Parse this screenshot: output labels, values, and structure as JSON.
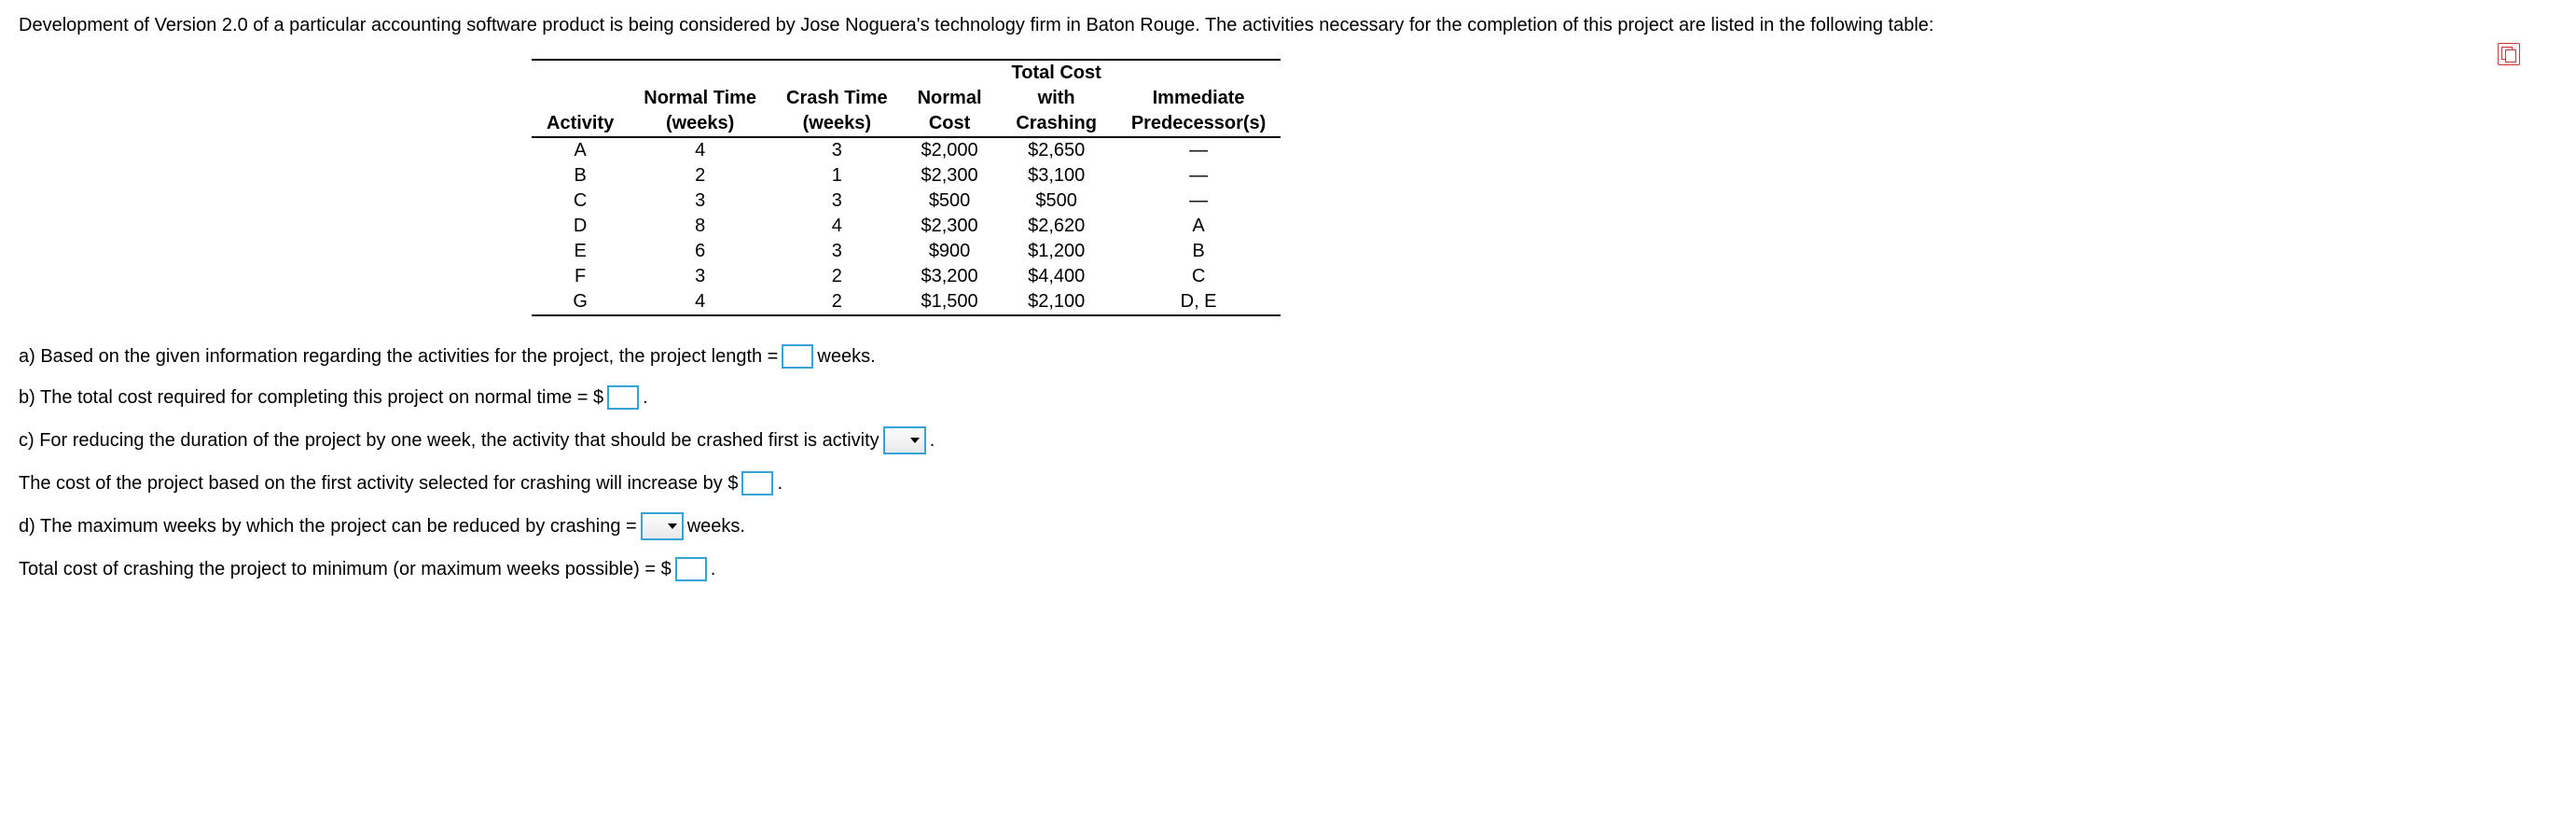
{
  "intro": "Development of Version 2.0 of a particular accounting software product is being considered by Jose Noguera's technology firm in Baton Rouge. The activities necessary for the completion of this project are listed in the following table:",
  "table": {
    "headers": {
      "activity": "Activity",
      "normal_time_l1": "Normal Time",
      "normal_time_l2": "(weeks)",
      "crash_time_l1": "Crash Time",
      "crash_time_l2": "(weeks)",
      "normal_cost_l1": "Normal",
      "normal_cost_l2": "Cost",
      "total_cost_l1": "Total Cost",
      "total_cost_l2": "with",
      "total_cost_l3": "Crashing",
      "predecessor_l1": "Immediate",
      "predecessor_l2": "Predecessor(s)"
    },
    "rows": [
      {
        "activity": "A",
        "normal_time": "4",
        "crash_time": "3",
        "normal_cost": "$2,000",
        "total_cost": "$2,650",
        "pred": "—"
      },
      {
        "activity": "B",
        "normal_time": "2",
        "crash_time": "1",
        "normal_cost": "$2,300",
        "total_cost": "$3,100",
        "pred": "—"
      },
      {
        "activity": "C",
        "normal_time": "3",
        "crash_time": "3",
        "normal_cost": "$500",
        "total_cost": "$500",
        "pred": "—"
      },
      {
        "activity": "D",
        "normal_time": "8",
        "crash_time": "4",
        "normal_cost": "$2,300",
        "total_cost": "$2,620",
        "pred": "A"
      },
      {
        "activity": "E",
        "normal_time": "6",
        "crash_time": "3",
        "normal_cost": "$900",
        "total_cost": "$1,200",
        "pred": "B"
      },
      {
        "activity": "F",
        "normal_time": "3",
        "crash_time": "2",
        "normal_cost": "$3,200",
        "total_cost": "$4,400",
        "pred": "C"
      },
      {
        "activity": "G",
        "normal_time": "4",
        "crash_time": "2",
        "normal_cost": "$1,500",
        "total_cost": "$2,100",
        "pred": "D, E"
      }
    ]
  },
  "questions": {
    "a_pre": "a) Based on the given information regarding the activities for the project, the project length =",
    "a_post": "weeks.",
    "b_pre": "b) The total cost required for completing this project on normal time = $",
    "b_post": ".",
    "c_pre": "c) For reducing the duration of the project by one week, the activity that should be crashed first is activity",
    "c_post": ".",
    "c2_pre": "The cost of the project based on the first activity selected for crashing will increase by $",
    "c2_post": ".",
    "d_pre": "d) The maximum weeks by which the project can be reduced by crashing =",
    "d_post": "weeks.",
    "e_pre": "Total cost of crashing the project to minimum (or maximum weeks possible) = $",
    "e_post": "."
  }
}
